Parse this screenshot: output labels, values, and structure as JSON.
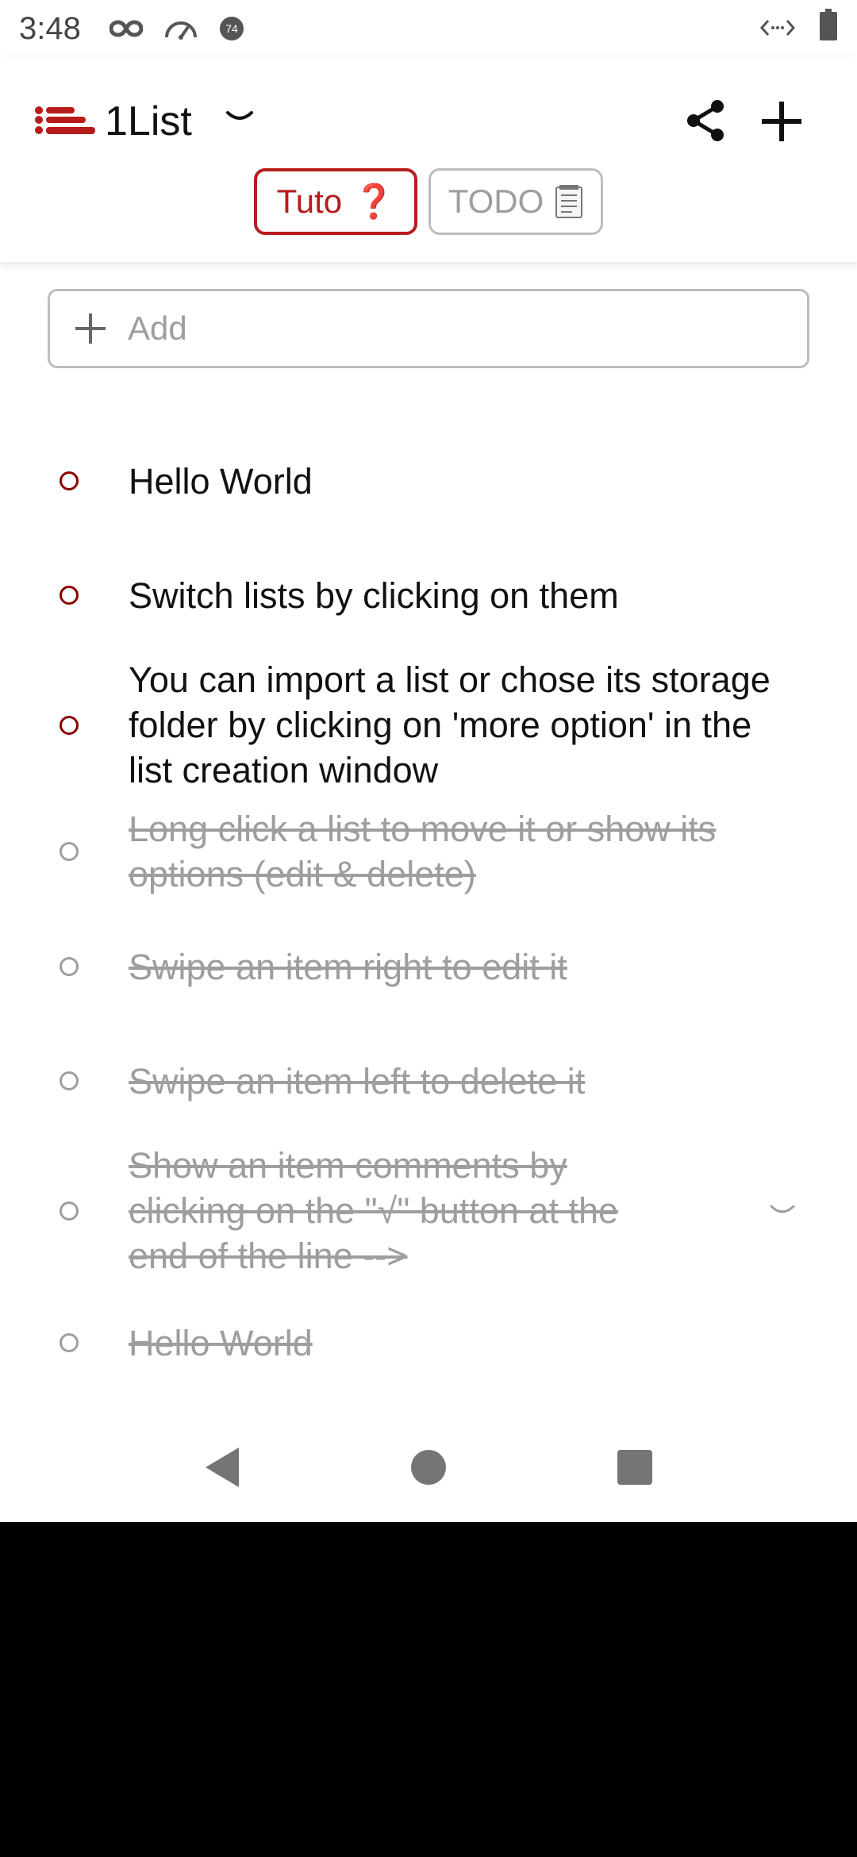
{
  "status_bar": {
    "time": "3:48",
    "badge": "74",
    "icons": [
      "infinity-icon",
      "speedometer-icon",
      "notification-badge-icon",
      "code-arrows-icon",
      "battery-icon"
    ]
  },
  "header": {
    "title": "1List",
    "accent_color": "#b71c1c",
    "tabs": [
      {
        "label": "Tuto",
        "emoji": "❓",
        "active": true
      },
      {
        "label": "TODO",
        "emoji": "🗒",
        "active": false
      }
    ]
  },
  "add_input": {
    "placeholder": "Add"
  },
  "items": [
    {
      "text": "Hello World",
      "done": false
    },
    {
      "text": "Switch lists by clicking on them",
      "done": false
    },
    {
      "text": "You can import a list or chose its storage folder by clicking on 'more option' in the list creation window",
      "done": false
    },
    {
      "text": "Long click a list to move it or show its options (edit & delete)",
      "done": true
    },
    {
      "text": "Swipe an item right to edit it",
      "done": true
    },
    {
      "text": "Swipe an item left to delete it",
      "done": true
    },
    {
      "text": "Show an item comments by clicking on the \"√\" button at the end of the line -->",
      "done": true,
      "has_comment": true
    },
    {
      "text": "Hello World",
      "done": true
    }
  ],
  "nav": {
    "icons": [
      "back-triangle-icon",
      "home-circle-icon",
      "recents-square-icon"
    ]
  }
}
